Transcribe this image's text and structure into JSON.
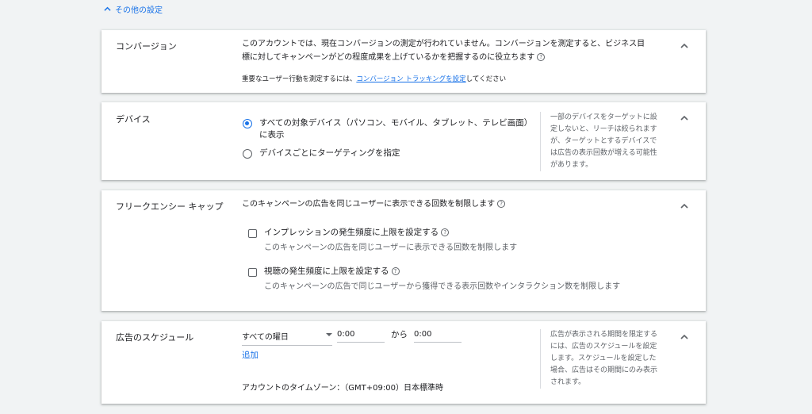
{
  "toggle": {
    "label": "その他の設定"
  },
  "conversion": {
    "title": "コンバージョン",
    "desc_line1": "このアカウントでは、現在コンバージョンの測定が行われていません。コンバージョンを測定すると、ビジネス目",
    "desc_line2": "標に対してキャンペーンがどの程度成果を上げているかを把握するのに役立ちます",
    "note_prefix": "重要なユーザー行動を測定するには、",
    "note_link": "コンバージョン トラッキングを設定",
    "note_suffix": "してください"
  },
  "device": {
    "title": "デバイス",
    "option1_line1": "すべての対象デバイス（パソコン、モバイル、タブレット、テレビ画面）",
    "option1_line2": "に表示",
    "option2": "デバイスごとにターゲティングを指定",
    "side_lines": [
      "一部のデバイスをターゲットに設",
      "定しないと、リーチは絞られます",
      "が、ターゲットとするデバイスで",
      "は広告の表示回数が増える可能性",
      "があります。"
    ]
  },
  "frequency": {
    "title": "フリークエンシー キャップ",
    "desc": "このキャンペーンの広告を同じユーザーに表示できる回数を制限します",
    "opt1_label": "インプレッションの発生頻度に上限を設定する",
    "opt1_sub": "このキャンペーンの広告を同じユーザーに表示できる回数を制限します",
    "opt2_label": "視聴の発生頻度に上限を設定する",
    "opt2_sub": "このキャンペーンの広告で同じユーザーから獲得できる表示回数やインタラクション数を制限します"
  },
  "schedule": {
    "title": "広告のスケジュール",
    "day": "すべての曜日",
    "start": "0:00",
    "from_label": "から",
    "end": "0:00",
    "add": "追加",
    "timezone": "アカウントのタイムゾーン：（GMT+09:00）日本標準時",
    "side_lines": [
      "広告が表示される期間を限定する",
      "には、広告のスケジュールを設定",
      "します。スケジュールを設定した",
      "場合、広告はその期間にのみ表示",
      "されます。"
    ]
  }
}
